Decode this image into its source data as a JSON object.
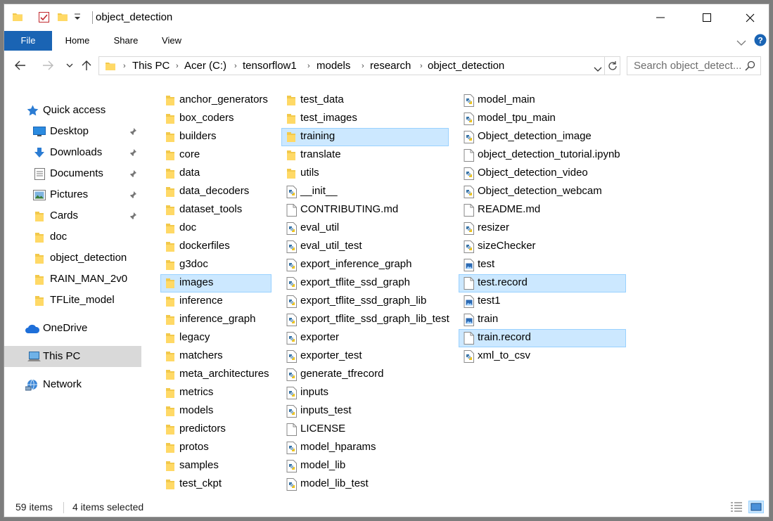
{
  "window": {
    "title": "object_detection"
  },
  "ribbon": {
    "tabs": [
      "File",
      "Home",
      "Share",
      "View"
    ]
  },
  "address": {
    "crumbs": [
      "This PC",
      "Acer (C:)",
      "tensorflow1",
      "models",
      "research",
      "object_detection"
    ],
    "search_placeholder": "Search object_detect..."
  },
  "nav": {
    "quick_access": "Quick access",
    "pinned": [
      {
        "label": "Desktop",
        "icon": "desktop-icon"
      },
      {
        "label": "Downloads",
        "icon": "downloads-icon"
      },
      {
        "label": "Documents",
        "icon": "documents-icon"
      },
      {
        "label": "Pictures",
        "icon": "pictures-icon"
      },
      {
        "label": "Cards",
        "icon": "folder-icon"
      }
    ],
    "folders": [
      "doc",
      "object_detection",
      "RAIN_MAN_2v0",
      "TFLite_model"
    ],
    "onedrive": "OneDrive",
    "this_pc": "This PC",
    "network": "Network"
  },
  "files": {
    "col1": [
      {
        "name": "anchor_generators",
        "type": "folder"
      },
      {
        "name": "box_coders",
        "type": "folder"
      },
      {
        "name": "builders",
        "type": "folder"
      },
      {
        "name": "core",
        "type": "folder"
      },
      {
        "name": "data",
        "type": "folder"
      },
      {
        "name": "data_decoders",
        "type": "folder"
      },
      {
        "name": "dataset_tools",
        "type": "folder"
      },
      {
        "name": "doc",
        "type": "folder"
      },
      {
        "name": "dockerfiles",
        "type": "folder"
      },
      {
        "name": "g3doc",
        "type": "folder"
      },
      {
        "name": "images",
        "type": "folder",
        "selected": true
      },
      {
        "name": "inference",
        "type": "folder"
      },
      {
        "name": "inference_graph",
        "type": "folder"
      },
      {
        "name": "legacy",
        "type": "folder"
      },
      {
        "name": "matchers",
        "type": "folder"
      },
      {
        "name": "meta_architectures",
        "type": "folder"
      },
      {
        "name": "metrics",
        "type": "folder"
      },
      {
        "name": "models",
        "type": "folder"
      },
      {
        "name": "predictors",
        "type": "folder"
      },
      {
        "name": "protos",
        "type": "folder"
      },
      {
        "name": "samples",
        "type": "folder"
      },
      {
        "name": "test_ckpt",
        "type": "folder"
      }
    ],
    "col2": [
      {
        "name": "test_data",
        "type": "folder"
      },
      {
        "name": "test_images",
        "type": "folder"
      },
      {
        "name": "training",
        "type": "folder",
        "selected": true
      },
      {
        "name": "translate",
        "type": "folder"
      },
      {
        "name": "utils",
        "type": "folder"
      },
      {
        "name": "__init__",
        "type": "python"
      },
      {
        "name": "CONTRIBUTING.md",
        "type": "doc"
      },
      {
        "name": "eval_util",
        "type": "python"
      },
      {
        "name": "eval_util_test",
        "type": "python"
      },
      {
        "name": "export_inference_graph",
        "type": "python"
      },
      {
        "name": "export_tflite_ssd_graph",
        "type": "python"
      },
      {
        "name": "export_tflite_ssd_graph_lib",
        "type": "python"
      },
      {
        "name": "export_tflite_ssd_graph_lib_test",
        "type": "python"
      },
      {
        "name": "exporter",
        "type": "python"
      },
      {
        "name": "exporter_test",
        "type": "python"
      },
      {
        "name": "generate_tfrecord",
        "type": "python"
      },
      {
        "name": "inputs",
        "type": "python"
      },
      {
        "name": "inputs_test",
        "type": "python"
      },
      {
        "name": "LICENSE",
        "type": "doc"
      },
      {
        "name": "model_hparams",
        "type": "python"
      },
      {
        "name": "model_lib",
        "type": "python"
      },
      {
        "name": "model_lib_test",
        "type": "python"
      }
    ],
    "col3": [
      {
        "name": "model_main",
        "type": "python"
      },
      {
        "name": "model_tpu_main",
        "type": "python"
      },
      {
        "name": "Object_detection_image",
        "type": "python"
      },
      {
        "name": "object_detection_tutorial.ipynb",
        "type": "doc"
      },
      {
        "name": "Object_detection_video",
        "type": "python"
      },
      {
        "name": "Object_detection_webcam",
        "type": "python"
      },
      {
        "name": "README.md",
        "type": "doc"
      },
      {
        "name": "resizer",
        "type": "python"
      },
      {
        "name": "sizeChecker",
        "type": "python"
      },
      {
        "name": "test",
        "type": "image"
      },
      {
        "name": "test.record",
        "type": "doc",
        "selected": true
      },
      {
        "name": "test1",
        "type": "image"
      },
      {
        "name": "train",
        "type": "image"
      },
      {
        "name": "train.record",
        "type": "doc",
        "selected": true
      },
      {
        "name": "xml_to_csv",
        "type": "python"
      }
    ]
  },
  "status": {
    "count": "59 items",
    "selected": "4 items selected"
  },
  "colors": {
    "accent": "#1a64b4",
    "folder": "#f2c94c",
    "selection": "#cce8ff"
  }
}
